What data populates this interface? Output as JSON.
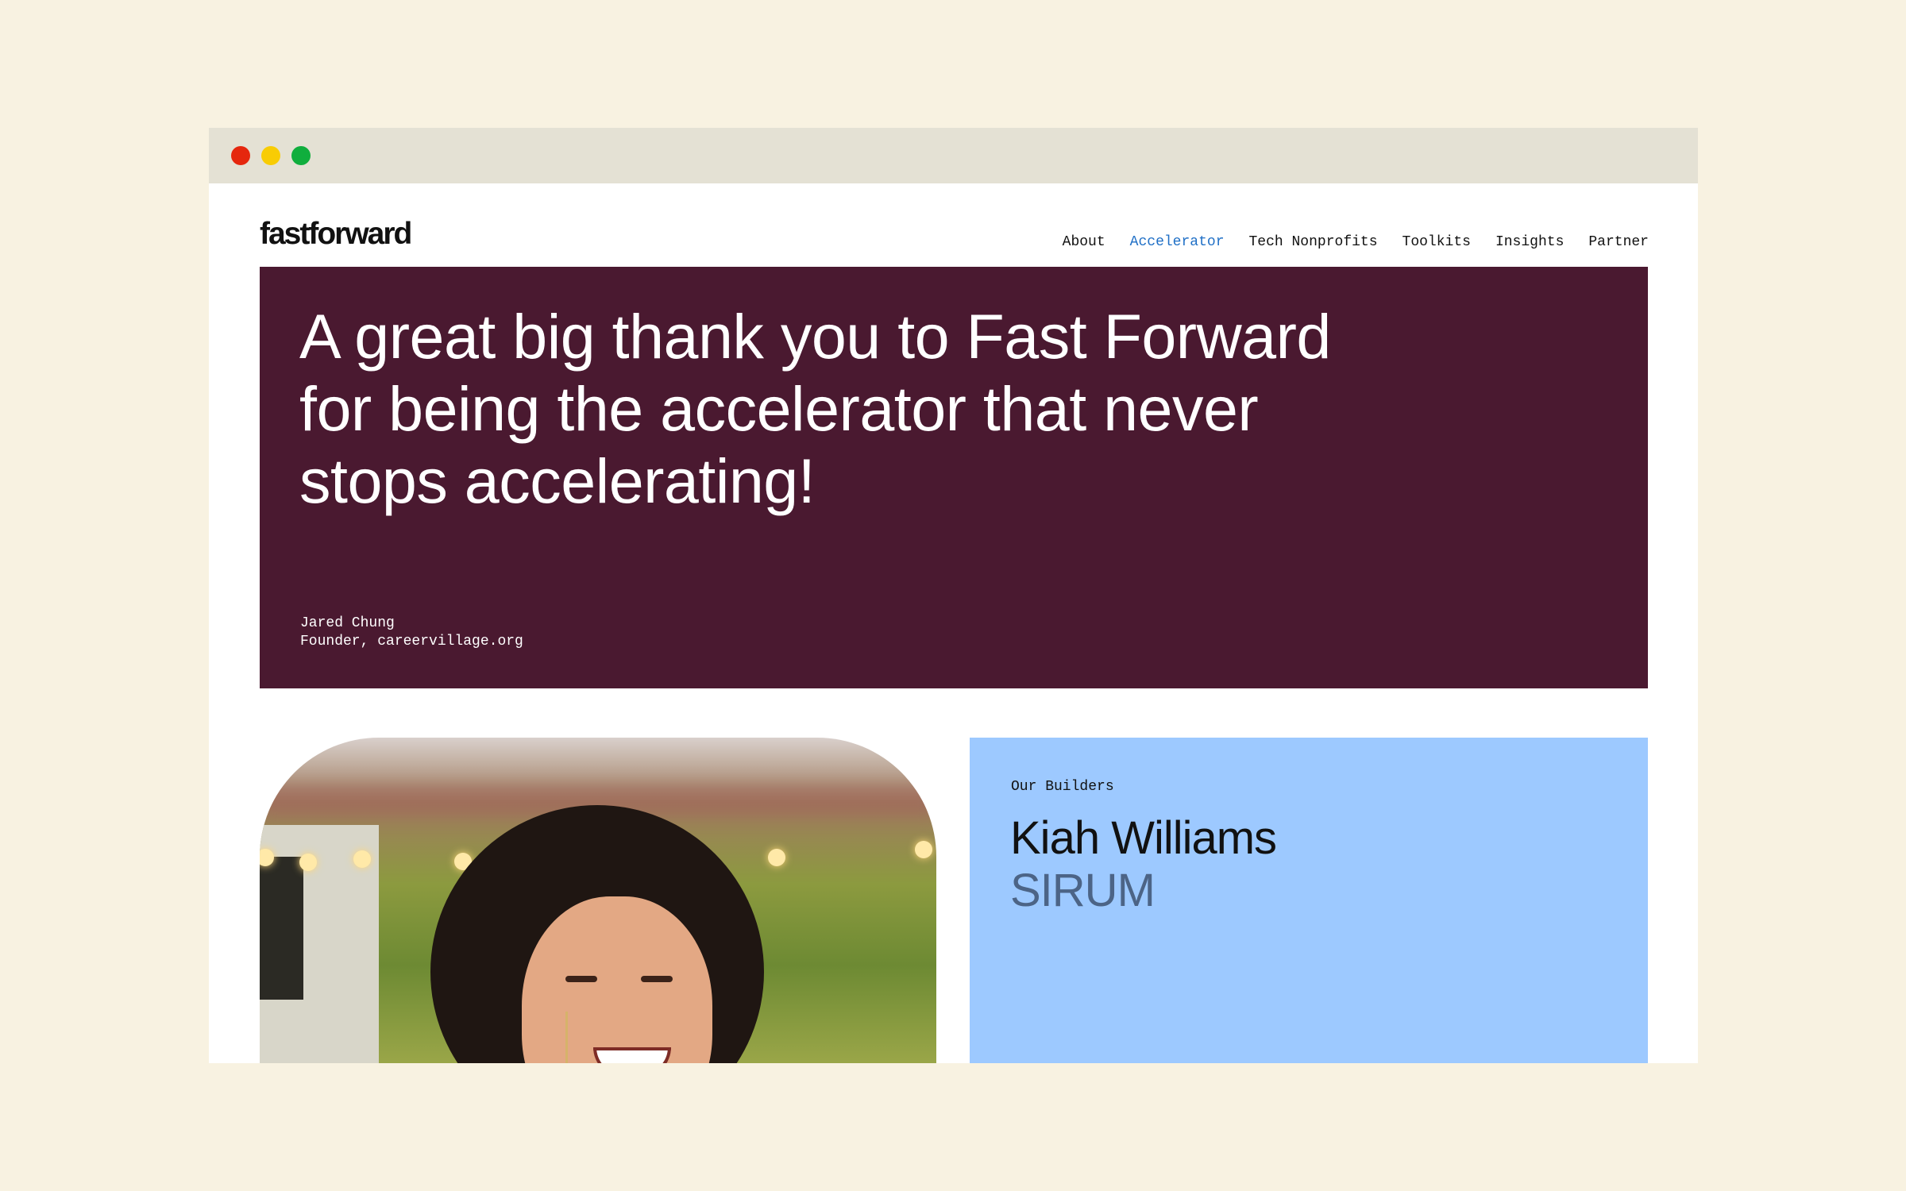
{
  "colors": {
    "page_background": "#f8f2e1",
    "titlebar": "#e4e1d4",
    "close": "#e5270e",
    "minimize": "#f8cc04",
    "maximize": "#10ae3d",
    "hero_background": "#4a1930",
    "nav_active": "#1f6fc6",
    "builder_card": "#9dc9ff",
    "builder_org_text": "#4c6486"
  },
  "header": {
    "logo": "fastforward"
  },
  "nav": {
    "items": [
      {
        "label": "About"
      },
      {
        "label": "Accelerator",
        "active": true
      },
      {
        "label": "Tech Nonprofits"
      },
      {
        "label": "Toolkits"
      },
      {
        "label": "Insights"
      },
      {
        "label": "Partner"
      }
    ]
  },
  "hero": {
    "quote": "A great big thank you to Fast Forward for being the accelerator that never stops accelerating!",
    "author": "Jared Chung",
    "author_title": "Founder, careervillage.org"
  },
  "builder": {
    "eyebrow": "Our Builders",
    "name": "Kiah Williams",
    "organization": "SIRUM"
  },
  "icons": {
    "close": "close-dot-icon",
    "minimize": "minimize-dot-icon",
    "maximize": "maximize-dot-icon"
  }
}
